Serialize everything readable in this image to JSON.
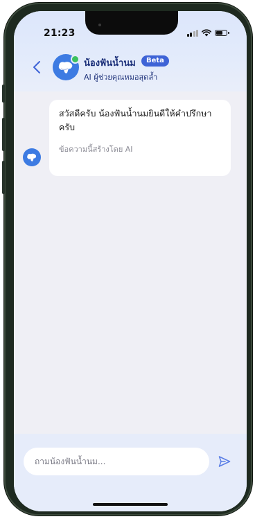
{
  "status_bar": {
    "time": "21:23",
    "battery_level": 0.7
  },
  "header": {
    "bot_name": "น้องฟันน้ำนม",
    "badge": "Beta",
    "subtitle": "AI ผู้ช่วยคุณหมอสุดล้ำ",
    "online": true
  },
  "chat": {
    "messages": [
      {
        "sender": "bot",
        "text": "สวัสดีครับ น้องฟันน้ำนมยินดีให้คำปรึกษาครับ",
        "note": "ข้อความนี้สร้างโดย AI"
      }
    ]
  },
  "composer": {
    "placeholder": "ถามน้องฟันน้ำนม...",
    "value": ""
  },
  "colors": {
    "accent": "#3e63d6",
    "title": "#1a2e78",
    "online": "#3bc15f",
    "send_icon": "#5b7fe6"
  },
  "icons": {
    "back": "chevron-left-icon",
    "avatar": "tooth-icon",
    "send": "send-icon"
  }
}
